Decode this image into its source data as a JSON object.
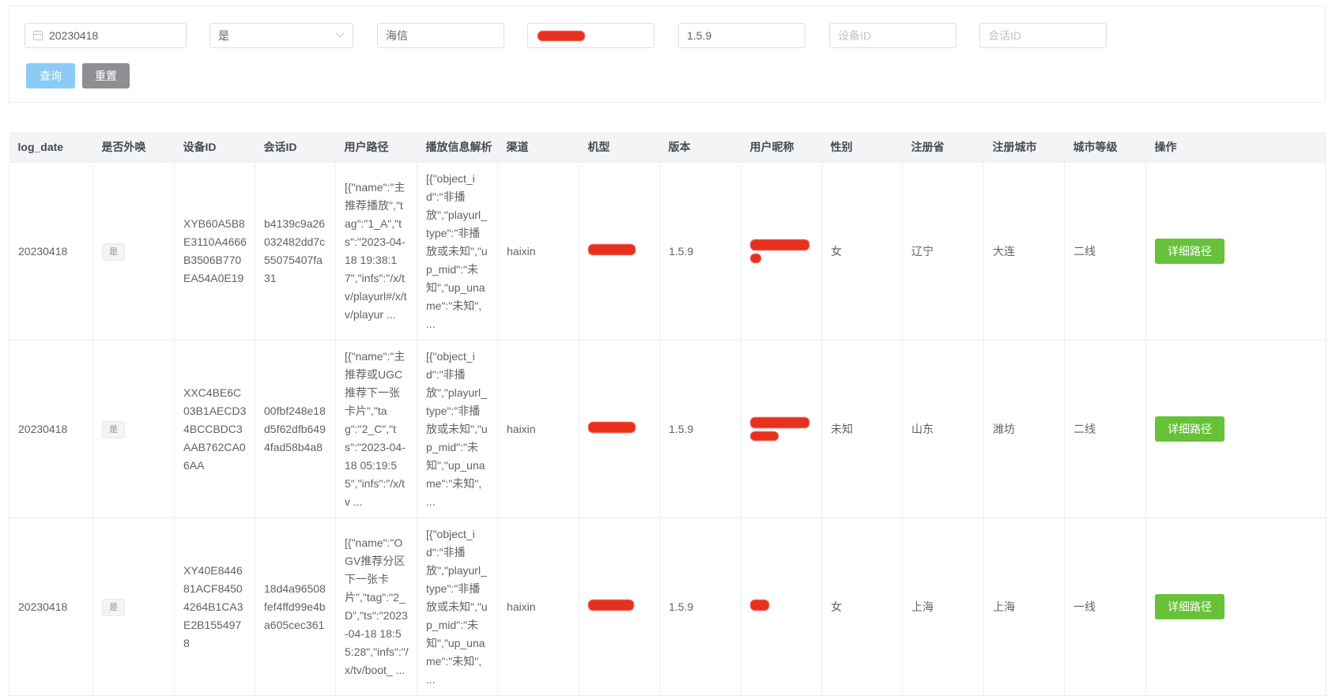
{
  "filters": {
    "date_value": "20230418",
    "external_select_value": "是",
    "channel_value": "海信",
    "version_value": "1.5.9",
    "device_id_placeholder": "设备ID",
    "session_id_placeholder": "会话ID"
  },
  "buttons": {
    "query": "查询",
    "reset": "重置"
  },
  "table": {
    "headers": [
      "log_date",
      "是否外唤",
      "设备ID",
      "会话ID",
      "用户路径",
      "播放信息解析",
      "渠道",
      "机型",
      "版本",
      "用户昵称",
      "性别",
      "注册省",
      "注册城市",
      "城市等级",
      "操作"
    ],
    "rows": [
      {
        "log_date": "20230418",
        "external": "是",
        "device_id": "XYB60A5B8E3110A4666B3506B770EA54A0E19",
        "session_id": "b4139c9a26032482dd7c55075407fa31",
        "user_path": "[{\"name\":\"主推荐播放\",\"tag\":\"1_A\",\"ts\":\"2023-04-18 19:38:17\",\"infs\":\"/x/tv/playurl#/x/tv/playur ...",
        "play_info": "[{\"object_id\":\"非播放\",\"playurl_type\":\"非播放或未知\",\"up_mid\":\"未知\",\"up_uname\":\"未知\", ...",
        "channel": "haixin",
        "version": "1.5.9",
        "gender": "女",
        "province": "辽宁",
        "city": "大连",
        "city_level": "二线",
        "action": "详细路径"
      },
      {
        "log_date": "20230418",
        "external": "是",
        "device_id": "XXC4BE6C03B1AECD34BCCBDC3AAB762CA06AA",
        "session_id": "00fbf248e18d5f62dfb6494fad58b4a8",
        "user_path": "[{\"name\":\"主推荐或UGC推荐下一张卡片\",\"tag\":\"2_C\",\"ts\":\"2023-04-18 05:19:55\",\"infs\":\"/x/tv ...",
        "play_info": "[{\"object_id\":\"非播放\",\"playurl_type\":\"非播放或未知\",\"up_mid\":\"未知\",\"up_uname\":\"未知\", ...",
        "channel": "haixin",
        "version": "1.5.9",
        "gender": "未知",
        "province": "山东",
        "city": "潍坊",
        "city_level": "二线",
        "action": "详细路径"
      },
      {
        "log_date": "20230418",
        "external": "是",
        "device_id": "XY40E844681ACF84504264B1CA3E2B1554978",
        "session_id": "18d4a96508fef4ffd99e4ba605cec361",
        "user_path": "[{\"name\":\"OGV推荐分区下一张卡片\",\"tag\":\"2_D\",\"ts\":\"2023-04-18 18:55:28\",\"infs\":\"/x/tv/boot_ ...",
        "play_info": "[{\"object_id\":\"非播放\",\"playurl_type\":\"非播放或未知\",\"up_mid\":\"未知\",\"up_uname\":\"未知\", ...",
        "channel": "haixin",
        "version": "1.5.9",
        "gender": "女",
        "province": "上海",
        "city": "上海",
        "city_level": "一线",
        "action": "详细路径"
      }
    ]
  }
}
